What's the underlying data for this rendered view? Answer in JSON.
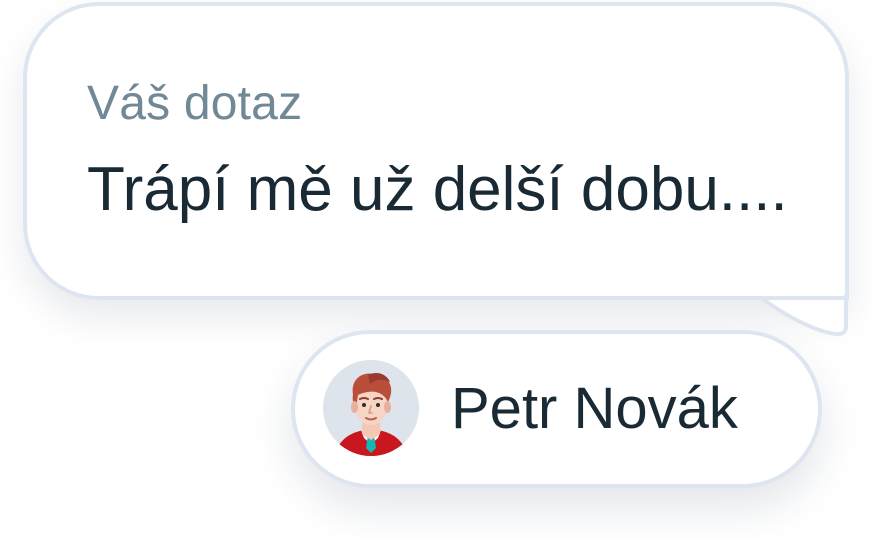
{
  "question": {
    "label": "Váš dotaz",
    "text": "Trápí mě už delší dobu...."
  },
  "author": {
    "name": "Petr Novák",
    "avatar_icon": "user-avatar-icon"
  },
  "colors": {
    "background": "#ffffff",
    "border": "#dde6f0",
    "muted_text": "#718896",
    "primary_text": "#1a2a35",
    "avatar_background": "#dde4eb",
    "avatar_sweater": "#c9171f",
    "avatar_tie": "#12b8b2"
  }
}
